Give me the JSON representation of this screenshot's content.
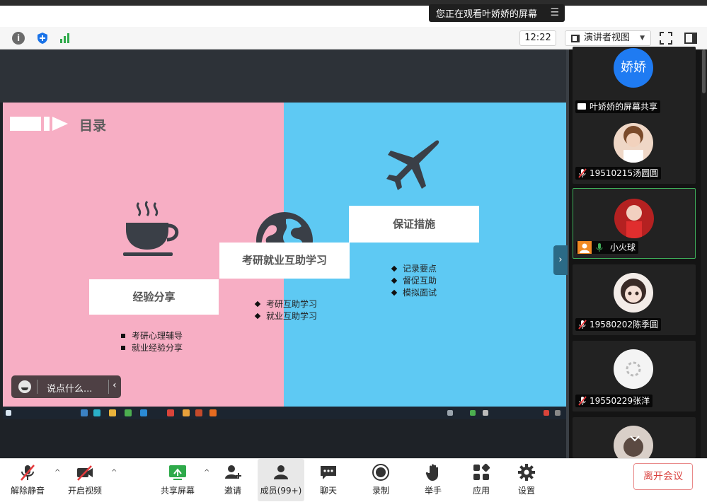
{
  "banner": {
    "text": "您正在观看叶娇娇的屏幕"
  },
  "toolbar": {
    "time": "12:22",
    "view_label": "演讲者视图"
  },
  "slide": {
    "title": "目录",
    "cards": [
      "经验分享",
      "考研就业互助学习",
      "保证措施"
    ],
    "bullets_1": [
      "考研心理辅导",
      "就业经验分享"
    ],
    "bullets_2": [
      "考研互助学习",
      "就业互助学习"
    ],
    "bullets_3": [
      "记录要点",
      "督促互助",
      "模拟面试"
    ]
  },
  "chat": {
    "placeholder": "说点什么..."
  },
  "participants": [
    {
      "name": "叶娇娇的屏幕共享",
      "avatar_text": "娇娇",
      "state": "screen-share"
    },
    {
      "name": "19510215汤圆圆",
      "state": "muted"
    },
    {
      "name": "小火球",
      "state": "speaking"
    },
    {
      "name": "19580202陈季圆",
      "state": "muted"
    },
    {
      "name": "19550229张洋",
      "state": "muted"
    }
  ],
  "controls": {
    "unmute": "解除静音",
    "start_video": "开启视频",
    "share_screen": "共享屏幕",
    "invite": "邀请",
    "members": "成员(99+)",
    "chat": "聊天",
    "record": "录制",
    "raise_hand": "举手",
    "apps": "应用",
    "settings": "设置",
    "leave": "离开会议"
  },
  "colors": {
    "slide_pink": "#f7aec4",
    "slide_blue": "#5ec9f3",
    "accent_green": "#3fae5a",
    "leave_red": "#d9413e"
  }
}
